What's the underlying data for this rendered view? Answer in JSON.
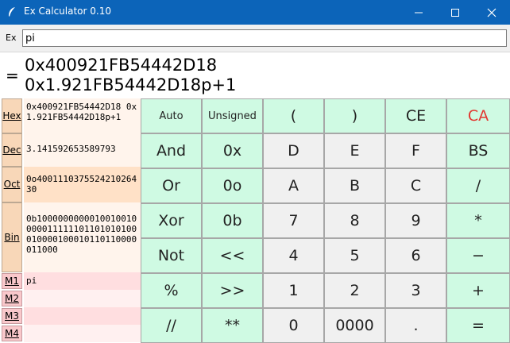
{
  "window": {
    "title": "Ex Calculator 0.10"
  },
  "expression": {
    "label": "Ex",
    "value": "pi"
  },
  "result": {
    "equals": "=",
    "line1": "0x400921FB54442D18",
    "line2": "0x1.921FB54442D18p+1"
  },
  "conversions": {
    "hex_label": "Hex",
    "hex_value": "0x400921FB54442D18 0x1.921FB54442D18p+1",
    "dec_label": "Dec",
    "dec_value": "3.141592653589793",
    "oct_label": "Oct",
    "oct_value": "0o400111037552421026430",
    "bin_label": "Bin",
    "bin_value": "0b1000000000010010010000011111101101010100010000100010110110000011000"
  },
  "memory": [
    {
      "label": "M1",
      "value": "pi"
    },
    {
      "label": "M2",
      "value": ""
    },
    {
      "label": "M3",
      "value": ""
    },
    {
      "label": "M4",
      "value": ""
    }
  ],
  "keypad": {
    "rows": [
      [
        "Auto",
        "Unsigned",
        "(",
        ")",
        "CE",
        "CA"
      ],
      [
        "And",
        "0x",
        "D",
        "E",
        "F",
        "BS"
      ],
      [
        "Or",
        "0o",
        "A",
        "B",
        "C",
        "/"
      ],
      [
        "Xor",
        "0b",
        "7",
        "8",
        "9",
        "*"
      ],
      [
        "Not",
        "<<",
        "4",
        "5",
        "6",
        "−"
      ],
      [
        "%",
        ">>",
        "1",
        "2",
        "3",
        "+"
      ],
      [
        "//",
        "**",
        "0",
        "0000",
        ".",
        "="
      ]
    ]
  },
  "colors": {
    "titlebar": "#0c64b9",
    "key_green": "#cffae3",
    "key_gray": "#f0f0f0",
    "side_orange": "#f8d7b8",
    "memory_pink": "#f9c8cb",
    "clear_all_red": "#e3362f"
  },
  "icons": {
    "app": "feather-icon",
    "minimize": "minimize-icon",
    "maximize": "maximize-icon",
    "close": "close-icon"
  }
}
